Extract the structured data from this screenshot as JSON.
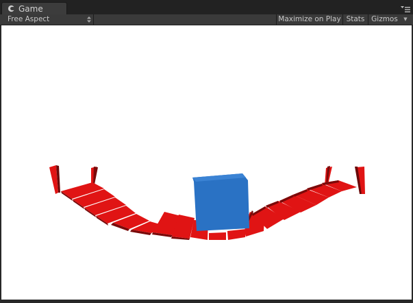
{
  "tab": {
    "label": "Game",
    "icon": "game-controller-icon"
  },
  "toolbar": {
    "aspect_label": "Free Aspect",
    "maximize_label": "Maximize on Play",
    "stats_label": "Stats",
    "gizmos_label": "Gizmos",
    "gizmos_arrow": "▼"
  },
  "scene": {
    "background_color": "#ffffff",
    "bridge_plank_color": "#e01414",
    "bridge_plank_shadow": "#8a0c0c",
    "cube_color": "#2a72c4",
    "cube_shade": "#1f5ea8"
  }
}
